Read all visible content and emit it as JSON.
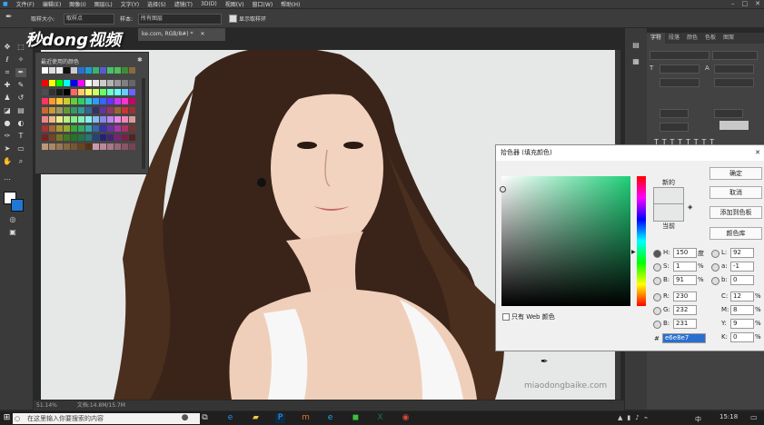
{
  "menu": {
    "items": [
      "文件(F)",
      "编辑(E)",
      "图像(I)",
      "图层(L)",
      "文字(Y)",
      "选择(S)",
      "滤镜(T)",
      "3D(D)",
      "视图(V)",
      "窗口(W)",
      "帮助(H)"
    ]
  },
  "options": {
    "sample_size_label": "取样大小:",
    "sample_size_value": "取样点",
    "sample_label": "样本:",
    "sample_value": "所有图层",
    "show_ring_label": "显示取样环"
  },
  "watermark_logo": "秒dong视频",
  "document": {
    "tab_title": "ke.com, RGB/8#) *",
    "zoom": "51.14%",
    "doc_size": "文档:14.8M/15.7M",
    "photo_watermark": "miaodongbaike.com"
  },
  "swatches": {
    "title": "最近使用的颜色"
  },
  "char_panel": {
    "tabs": [
      "字符",
      "段落",
      "颜色",
      "色板",
      "图案"
    ]
  },
  "picker": {
    "title": "拾色器 (填充颜色)",
    "new_label": "新的",
    "current_label": "当前",
    "ok": "确定",
    "cancel": "取消",
    "add_swatch": "添加到色板",
    "color_libraries": "颜色库",
    "web_only": "只有 Web 颜色",
    "H": "150",
    "H_unit": "度",
    "S": "1",
    "S_unit": "%",
    "B": "91",
    "B_unit": "%",
    "R": "230",
    "G": "232",
    "Bv": "231",
    "L": "92",
    "a": "-1",
    "b": "0",
    "C": "12",
    "M": "8",
    "Y": "9",
    "K": "0",
    "hex": "e6e8e7",
    "new_color": "#e6e8e7",
    "current_color": "#e6e8e7"
  },
  "taskbar": {
    "search_placeholder": "在这里输入你要搜索的内容",
    "time": "15:18",
    "lang": "中"
  }
}
